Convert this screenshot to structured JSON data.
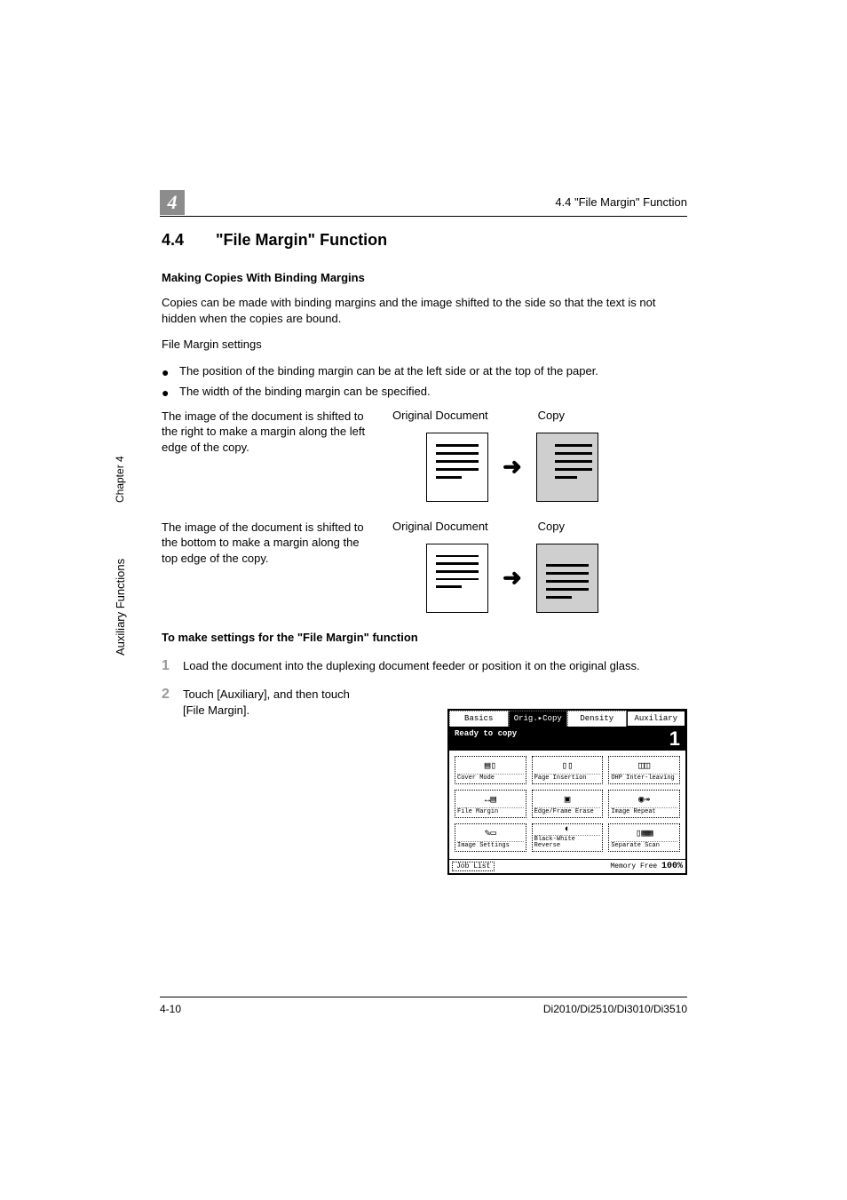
{
  "header": {
    "chapter_badge": "4",
    "running_title": "4.4   \"File Margin\" Function"
  },
  "sidebar": {
    "chapter_label": "Chapter 4",
    "section_label": "Auxiliary Functions"
  },
  "section": {
    "number": "4.4",
    "title": "\"File Margin\" Function"
  },
  "sub1": {
    "heading": "Making Copies With Binding Margins",
    "para1": "Copies can be made with binding margins and the image shifted to the side so that the text is not hidden when the copies are bound.",
    "para2": "File Margin settings",
    "bullets": [
      "The position of the binding margin can be at the left side or at the top of the paper.",
      "The width of the binding margin can be specified."
    ]
  },
  "shift_left": {
    "desc": "The image of the document is shifted to the right to make a margin along the left edge of the copy.",
    "label_original": "Original Document",
    "label_copy": "Copy"
  },
  "shift_top": {
    "desc": "The image of the document is shifted to the bottom to make a margin along the top edge of the copy.",
    "label_original": "Original Document",
    "label_copy": "Copy"
  },
  "sub2": {
    "heading": "To make settings for the \"File Margin\" function"
  },
  "steps": [
    "Load the document into the duplexing document feeder or position it on the original glass.",
    "Touch [Auxiliary], and then touch [File Margin]."
  ],
  "screenshot": {
    "tabs": {
      "basics": "Basics",
      "orig": "Orig.▸Copy",
      "density": "Density",
      "aux": "Auxiliary"
    },
    "status_text": "Ready to copy",
    "count": "1",
    "buttons": {
      "cover": "Cover Mode",
      "page_ins": "Page Insertion",
      "ohp": "OHP Inter-leaving",
      "file_margin": "File Margin",
      "edge": "Edge/Frame Erase",
      "repeat": "Image Repeat",
      "image_settings": "Image Settings",
      "bw_rev": "Black-White Reverse",
      "sep_scan": "Separate Scan"
    },
    "job_list": "Job List",
    "memory_label": "Memory Free",
    "memory_pct": "100%"
  },
  "footer": {
    "page": "4-10",
    "models": "Di2010/Di2510/Di3010/Di3510"
  }
}
